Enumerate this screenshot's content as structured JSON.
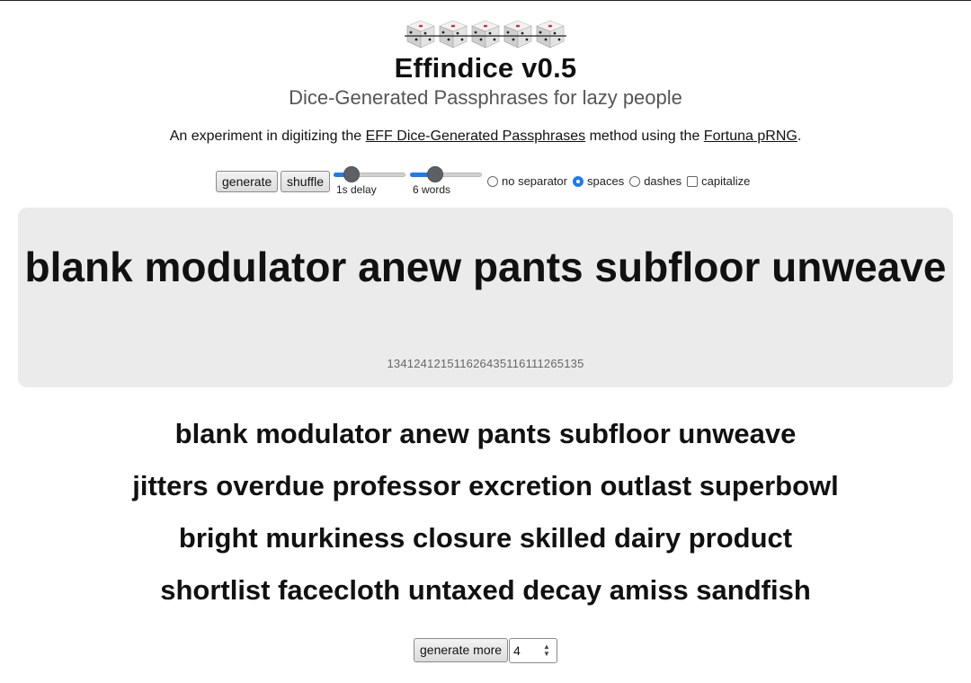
{
  "header": {
    "dice_icons": [
      "die-icon",
      "die-icon",
      "die-icon",
      "die-icon",
      "die-icon"
    ],
    "title": "Effindice v0.5",
    "subtitle": "Dice-Generated Passphrases for lazy people",
    "intro": {
      "prefix": "An experiment in digitizing the ",
      "link1": "EFF Dice-Generated Passphrases",
      "middle": " method using the ",
      "link2": "Fortuna pRNG",
      "suffix": "."
    }
  },
  "controls": {
    "generate_label": "generate",
    "shuffle_label": "shuffle",
    "delay_slider": {
      "label": "1s delay",
      "value_fraction": 0.18
    },
    "words_slider": {
      "label": "6 words",
      "value_fraction": 0.3
    },
    "separator_options": [
      {
        "label": "no separator",
        "selected": false
      },
      {
        "label": "spaces",
        "selected": true
      },
      {
        "label": "dashes",
        "selected": false
      }
    ],
    "capitalize": {
      "label": "capitalize",
      "checked": false
    },
    "accent_color": "#1a7cf2"
  },
  "result": {
    "passphrase": "blank modulator anew pants subfloor unweave",
    "dice_digits": "13412412151162643511611126513 5"
  },
  "history": [
    "blank modulator anew pants subfloor unweave",
    "jitters overdue professor excretion outlast superbowl",
    "bright murkiness closure skilled dairy product",
    "shortlist facecloth untaxed decay amiss sandfish"
  ],
  "generate_more": {
    "button_label": "generate more",
    "count_value": "4"
  }
}
